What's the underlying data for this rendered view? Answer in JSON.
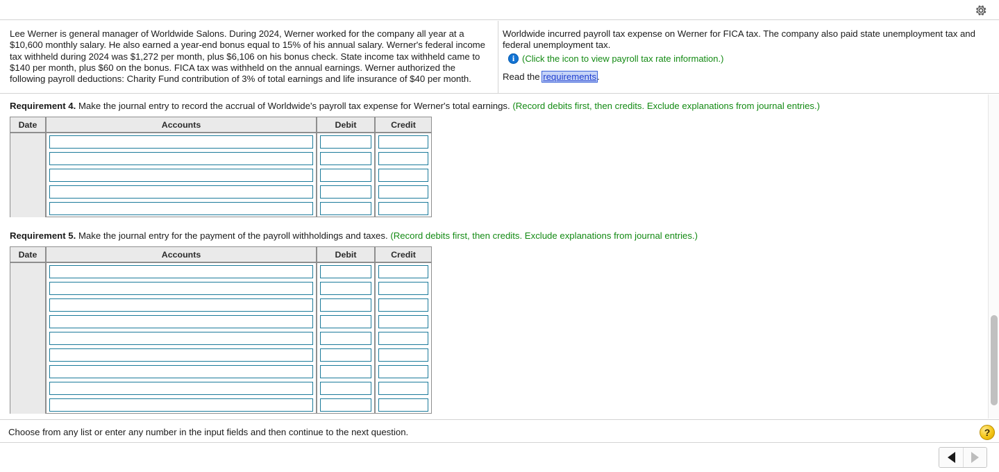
{
  "topbar": {
    "gear_icon": "gear-icon"
  },
  "problem": {
    "left_text": "Lee Werner is general manager of Worldwide Salons. During 2024, Werner worked for the company all year at a $10,600 monthly salary. He also earned a year-end bonus equal to 15% of his annual salary. Werner's federal income tax withheld during 2024 was $1,272 per month, plus $6,106 on his bonus check. State income tax withheld came to $140 per month, plus $60 on the bonus. FICA tax was withheld on the annual earnings. Werner authorized the following payroll deductions: Charity Fund contribution of 3% of total earnings and life insurance of $40 per month.",
    "right_text": "Worldwide incurred payroll tax expense on Werner for FICA tax. The company also paid state unemployment tax and federal unemployment tax.",
    "info_icon_glyph": "i",
    "info_link_text": "(Click the icon to view payroll tax rate information.)",
    "read_prefix": "Read the ",
    "read_link": "requirements",
    "read_suffix": "."
  },
  "requirements": [
    {
      "number_label": "Requirement 4.",
      "instruction": " Make the journal entry to record the accrual of Worldwide's payroll tax expense for Werner's total earnings. ",
      "note": "(Record debits first, then credits. Exclude explanations from journal entries.)",
      "columns": [
        "Date",
        "Accounts",
        "Debit",
        "Credit"
      ],
      "row_count": 5
    },
    {
      "number_label": "Requirement 5.",
      "instruction": " Make the journal entry for the payment of the payroll withholdings and taxes. ",
      "note": "(Record debits first, then credits. Exclude explanations from journal entries.)",
      "columns": [
        "Date",
        "Accounts",
        "Debit",
        "Credit"
      ],
      "row_count": 9
    }
  ],
  "statusbar": {
    "message": "Choose from any list or enter any number in the input fields and then continue to the next question.",
    "help_glyph": "?"
  },
  "nav": {
    "prev_icon": "triangle-left-icon",
    "next_icon": "triangle-right-icon"
  },
  "colors": {
    "green_note": "#138a13",
    "link_blue": "#1f3fd0",
    "info_blue": "#1273d4",
    "field_border": "#1a7a9a",
    "header_bg": "#eaeaea"
  }
}
